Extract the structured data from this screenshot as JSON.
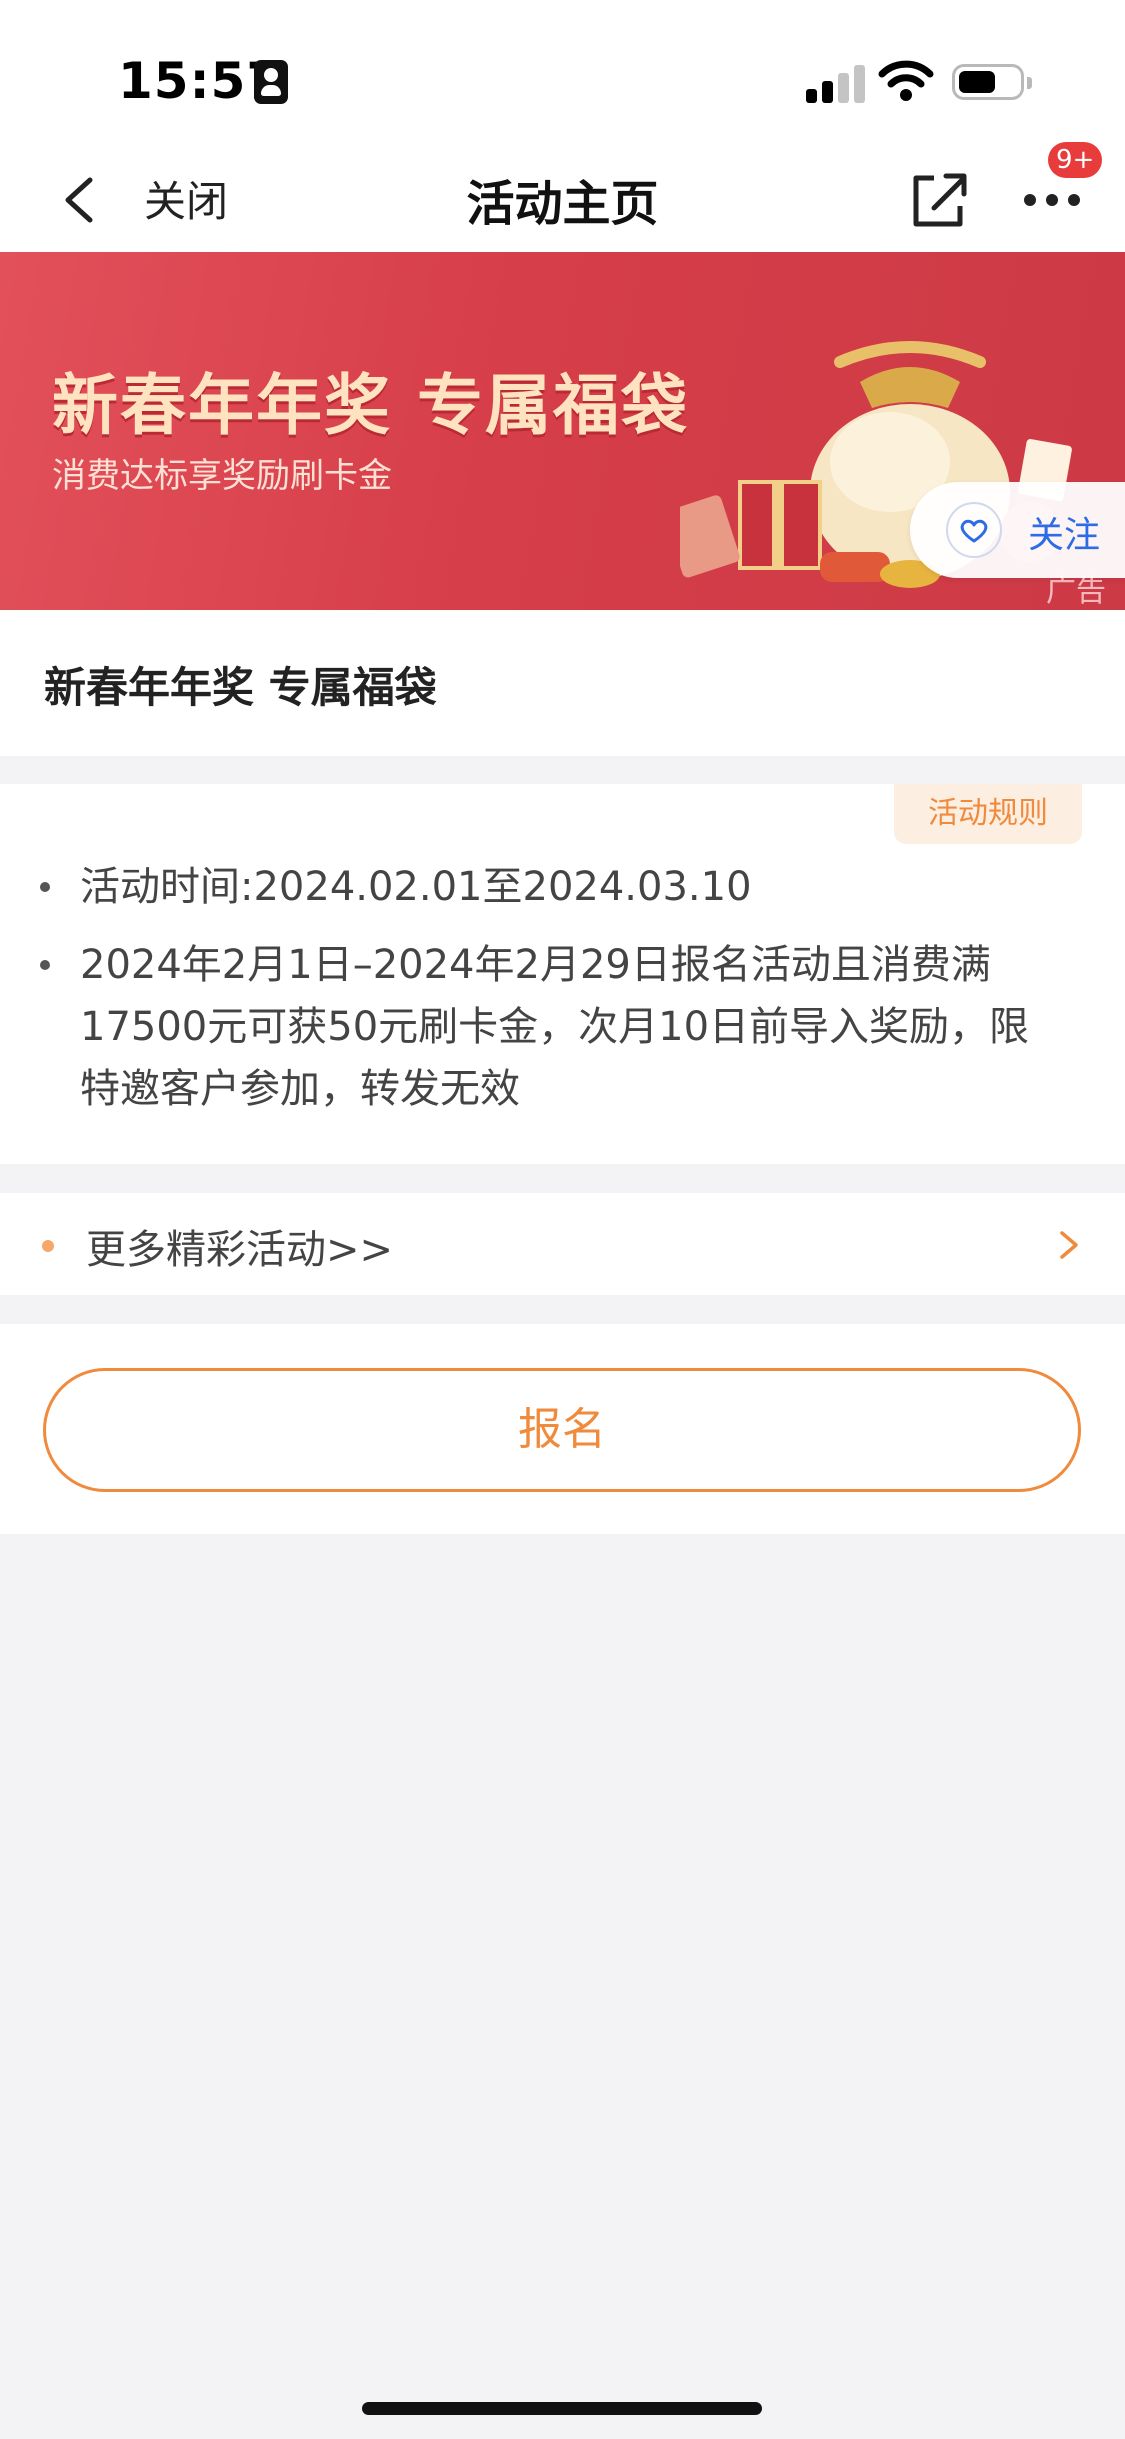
{
  "status_bar": {
    "time": "15:57"
  },
  "nav": {
    "close_label": "关闭",
    "title": "活动主页",
    "badge": "9+"
  },
  "banner": {
    "title": "新春年年奖 专属福袋",
    "subtitle": "消费达标享奖励刷卡金",
    "ad_label": "广告",
    "follow_label": "关注"
  },
  "activity": {
    "name": "新春年年奖 专属福袋",
    "rules_label": "活动规则",
    "time_line": "活动时间:2024.02.01至2024.03.10",
    "desc_lines": [
      "2024年2月1日–2024年2月29日报名活动且消费满",
      "17500元可获50元刷卡金，次月10日前导入奖励，限",
      "特邀客户参加，转发无效"
    ]
  },
  "more_link": {
    "label": "更多精彩活动>>"
  },
  "signup_button": {
    "label": "报名"
  },
  "colors": {
    "accent": "#f08a3c",
    "banner_red": "#d63e49",
    "badge_red": "#e83c3c",
    "link_blue": "#2e6be6"
  },
  "icons": [
    "person-card-icon",
    "signal-icon",
    "wifi-icon",
    "battery-icon",
    "back-arrow-icon",
    "share-icon",
    "more-icon",
    "heart-icon",
    "chevron-right-icon"
  ]
}
